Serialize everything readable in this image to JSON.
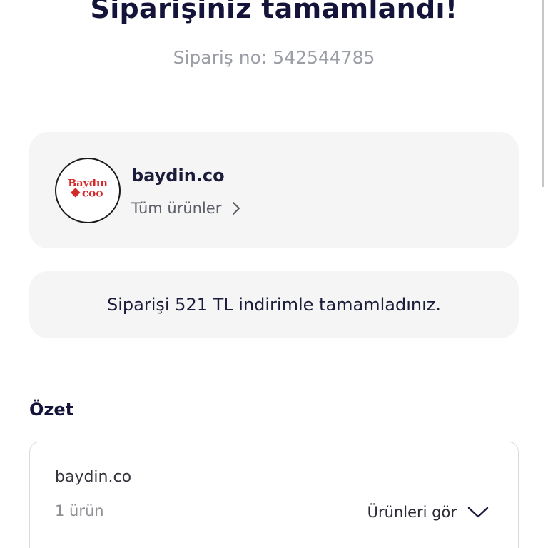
{
  "header": {
    "title": "Siparişiniz tamamlandı!",
    "order_number": "Sipariş no: 542544785"
  },
  "store": {
    "name": "baydin.co",
    "all_products_label": "Tüm ürünler",
    "logo": {
      "icon": "baydin-coo-logo",
      "text_top": "Baydın",
      "text_bottom": "coo",
      "color": "#d42a2a"
    }
  },
  "discount": {
    "message": "Siparişi 521 TL indirimle tamamladınız."
  },
  "summary": {
    "title": "Özet",
    "store_name": "baydin.co",
    "item_count": "1 ürün",
    "see_products_label": "Ürünleri gör"
  },
  "colors": {
    "primary_text": "#14143a",
    "muted_text": "#9b9ea6",
    "card_bg": "#f5f5f5",
    "brand_red": "#d42a2a"
  }
}
